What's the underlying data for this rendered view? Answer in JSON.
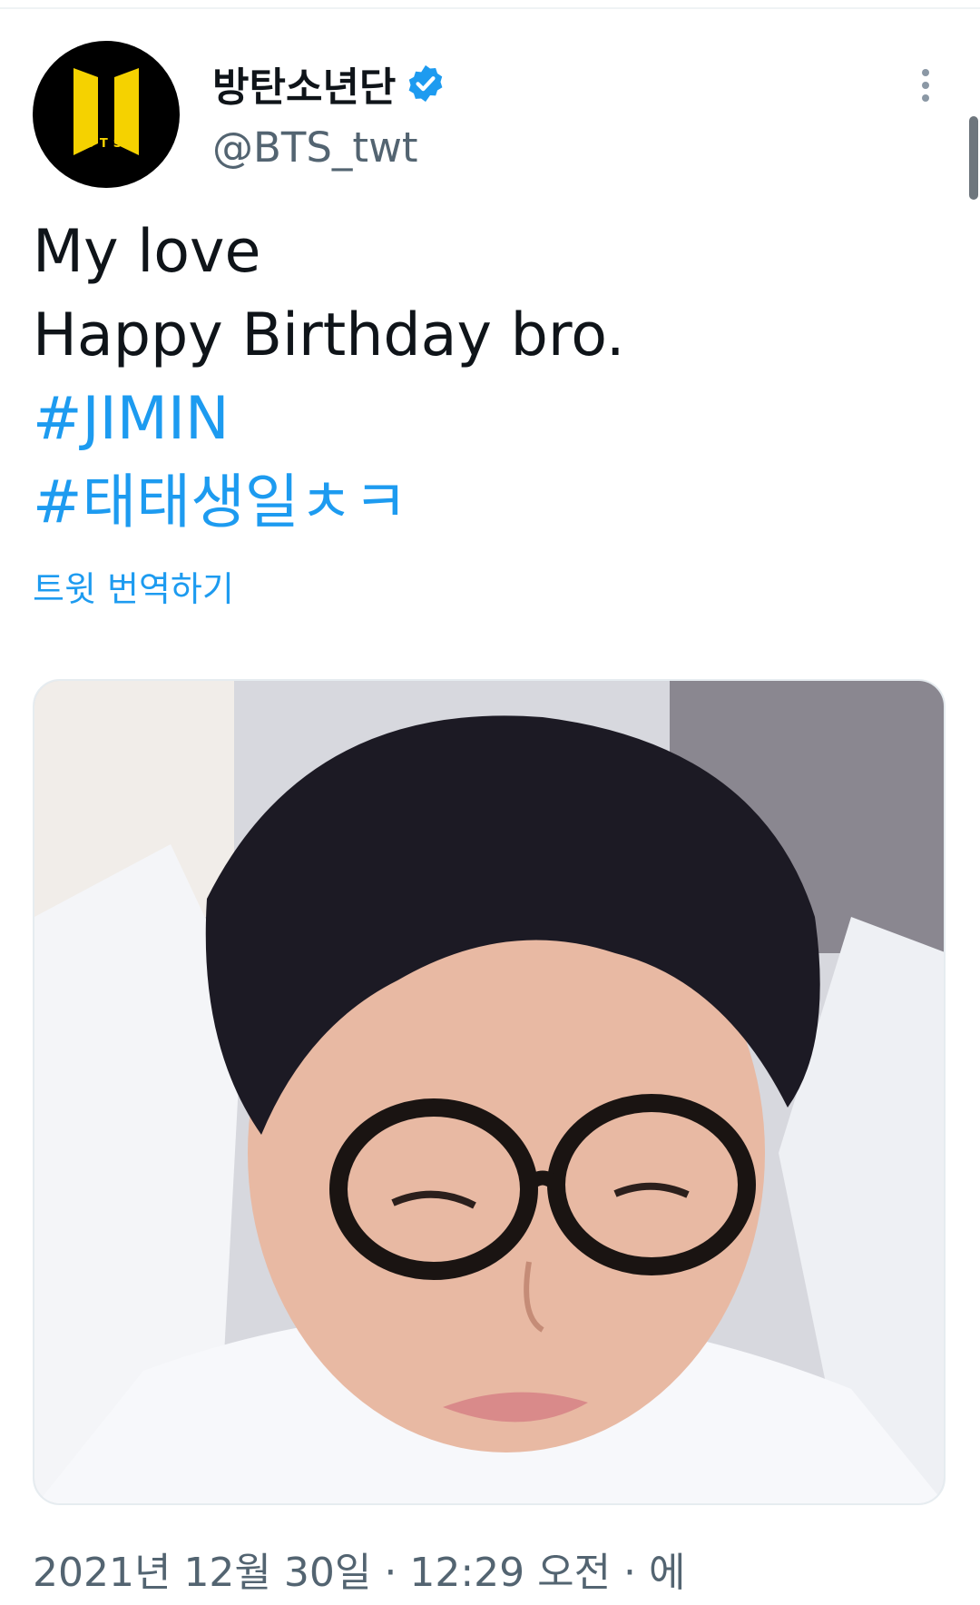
{
  "author": {
    "display_name": "방탄소년단",
    "handle": "@BTS_twt",
    "avatar_text": "BTS",
    "verified": true
  },
  "tweet": {
    "lines": [
      "My love",
      "Happy Birthday bro."
    ],
    "hashtags": [
      "#JIMIN",
      "#태태생일ㅊㅋ"
    ],
    "translate_label": "트윗 번역하기"
  },
  "timestamp": "2021년 12월 30일 · 12:29 오전 · 에",
  "icons": {
    "verified": "verified-badge-icon",
    "more": "more-dots-icon"
  },
  "colors": {
    "link": "#1d9bf0",
    "secondary_text": "#536471",
    "avatar_bg": "#000000",
    "avatar_logo": "#f5d200"
  }
}
